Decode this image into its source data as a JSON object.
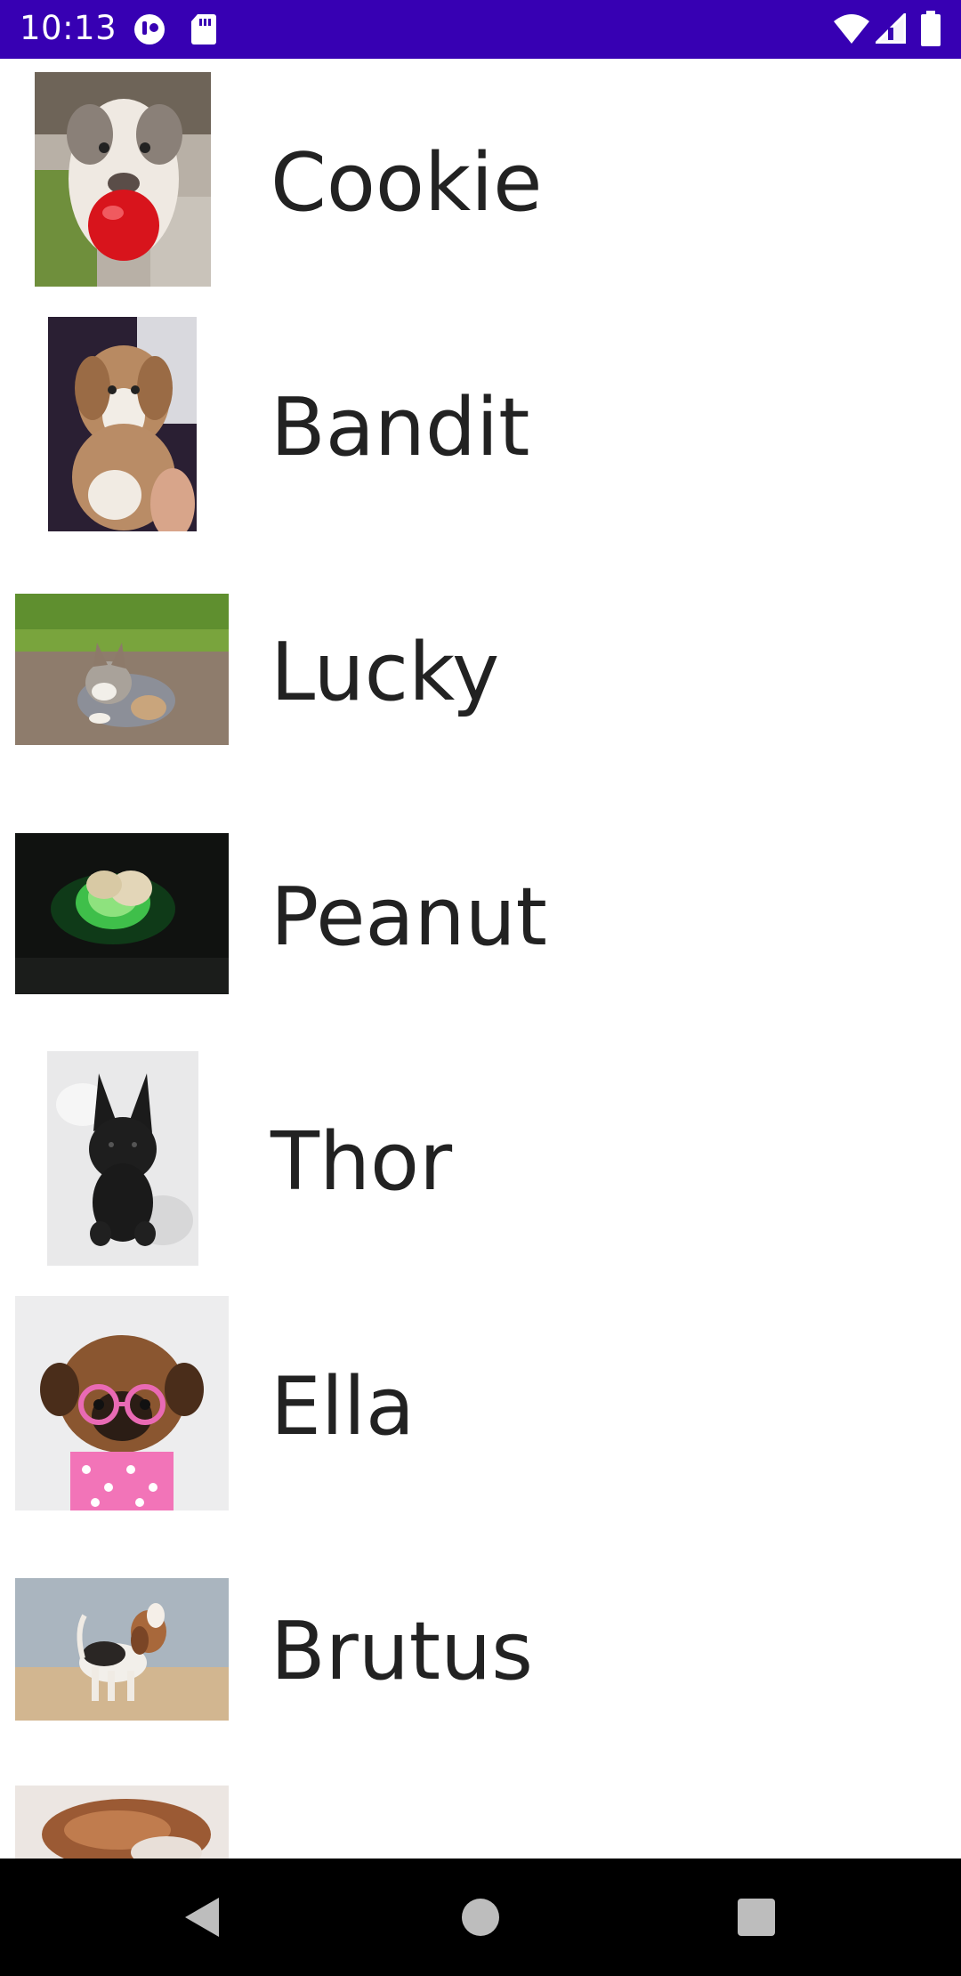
{
  "status_bar": {
    "time": "10:13",
    "left_icons": [
      "app-notification-icon",
      "sd-card-icon"
    ],
    "right_icons": [
      "wifi-icon",
      "cellular-signal-icon",
      "battery-icon"
    ],
    "background": "#3700b3"
  },
  "dogs": [
    {
      "name": "Cookie",
      "photo": "pit-bull-with-red-ball"
    },
    {
      "name": "Bandit",
      "photo": "brown-white-puppy-held"
    },
    {
      "name": "Lucky",
      "photo": "corgi-puppy-on-grass"
    },
    {
      "name": "Peanut",
      "photo": "pomeranian-green-glow"
    },
    {
      "name": "Thor",
      "photo": "black-puppy-on-white-fur"
    },
    {
      "name": "Ella",
      "photo": "puppy-with-pink-glasses"
    },
    {
      "name": "Brutus",
      "photo": "beagle-puppy-howling"
    },
    {
      "name": "",
      "photo": "brown-dog-partial"
    }
  ],
  "nav_bar": {
    "buttons": [
      "back-icon",
      "home-icon",
      "recents-icon"
    ]
  }
}
